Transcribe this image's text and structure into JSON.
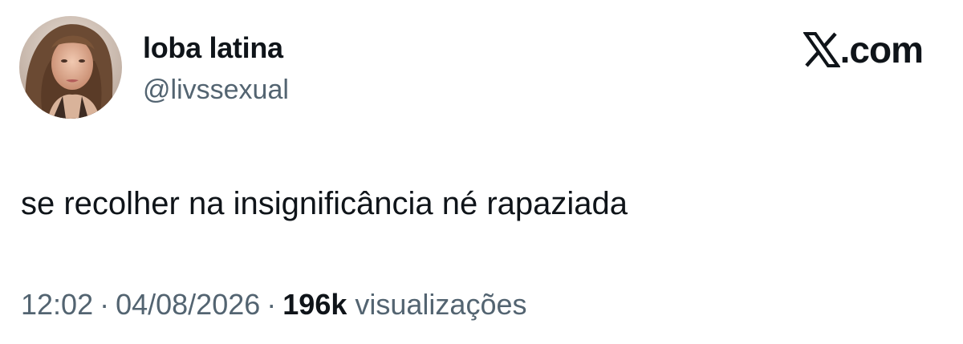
{
  "author": {
    "display_name": "loba latina",
    "handle": "@livssexual",
    "avatar_icon": "profile-photo"
  },
  "brand": {
    "icon": "x-logo-icon",
    "domain": ".com"
  },
  "tweet": {
    "text": "se recolher na insignificância né rapaziada"
  },
  "meta": {
    "time": "12:02",
    "separator": "·",
    "date": "04/08/2026",
    "views_count": "196k",
    "views_label": "visualizações"
  },
  "colors": {
    "text_primary": "#0f1419",
    "text_secondary": "#536471",
    "background": "#ffffff"
  }
}
